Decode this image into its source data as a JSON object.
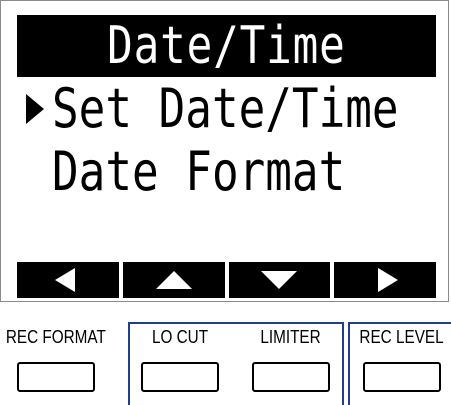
{
  "screen": {
    "title": "Date/Time",
    "menu": [
      {
        "label": "Set Date/Time",
        "selected": true
      },
      {
        "label": "Date Format",
        "selected": false
      }
    ],
    "function_keys": [
      {
        "icon": "left-arrow-icon"
      },
      {
        "icon": "up-arrow-icon"
      },
      {
        "icon": "down-arrow-icon"
      },
      {
        "icon": "right-arrow-icon"
      }
    ]
  },
  "hardware_buttons": [
    {
      "label": "REC FORMAT"
    },
    {
      "label": "LO CUT"
    },
    {
      "label": "LIMITER"
    },
    {
      "label": "REC LEVEL"
    }
  ],
  "colors": {
    "screen_bg": "#ffffff",
    "title_bg": "#000000",
    "group_outline": "#1f3f8a"
  }
}
